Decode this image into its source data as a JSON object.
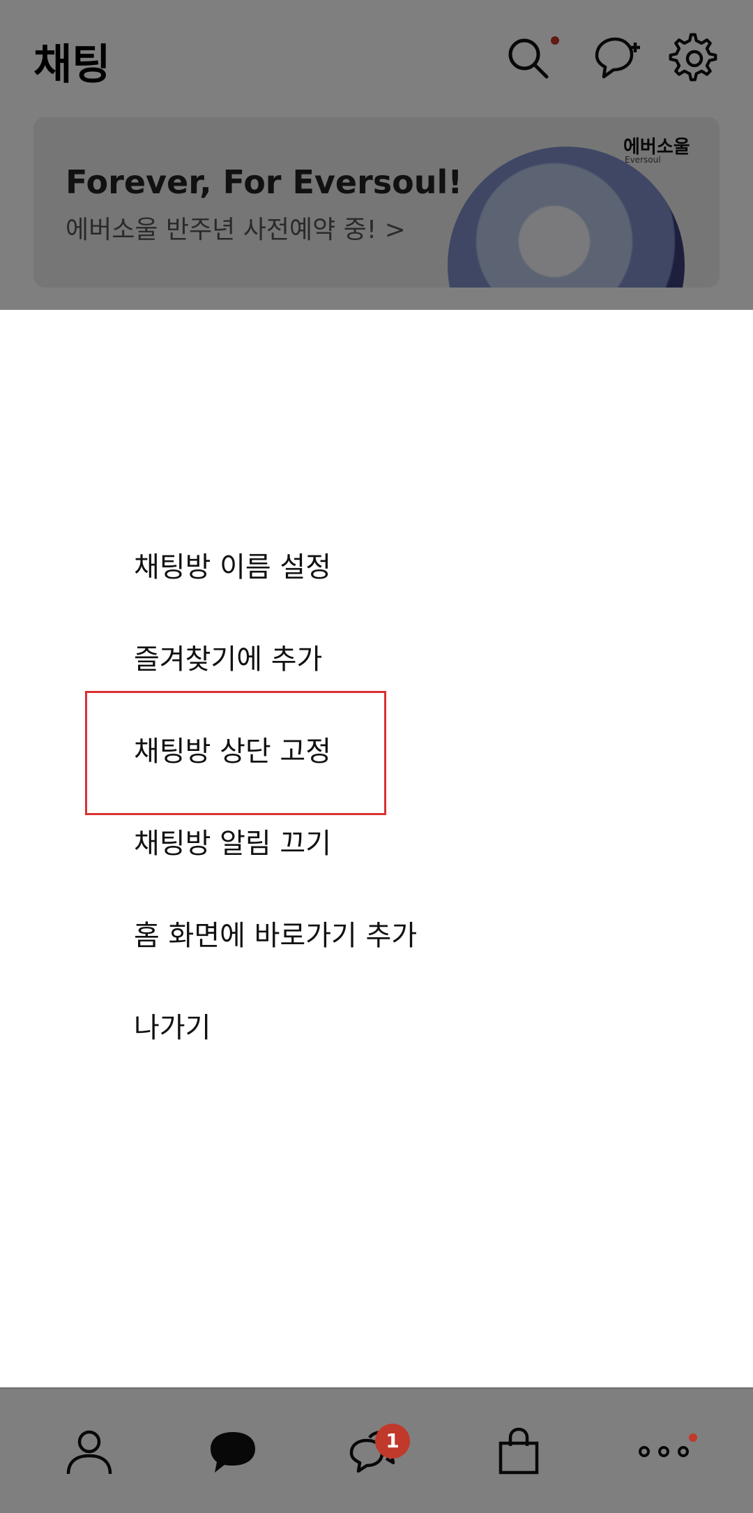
{
  "header": {
    "title": "채팅",
    "icons": [
      "search-icon",
      "new-chat-icon",
      "gear-icon"
    ]
  },
  "banner": {
    "title": "Forever, For Eversoul!",
    "subtitle": "에버소울 반주년 사전예약 중! >",
    "brand": "에버소울",
    "brand_sub": "Eversoul"
  },
  "menu": {
    "items": [
      {
        "label": "채팅방 이름 설정"
      },
      {
        "label": "즐겨찾기에 추가"
      },
      {
        "label": "채팅방 상단 고정"
      },
      {
        "label": "채팅방 알림 끄기"
      },
      {
        "label": "홈 화면에 바로가기 추가"
      },
      {
        "label": "나가기"
      }
    ]
  },
  "tabbar": {
    "tabs": [
      "friends-icon",
      "chats-icon",
      "openchat-icon",
      "shopping-icon",
      "more-icon"
    ],
    "openchat_badge": "1"
  },
  "colors": {
    "accent": "#d93030",
    "badge": "#c0392b",
    "dim": "rgba(0,0,0,0.5)"
  }
}
